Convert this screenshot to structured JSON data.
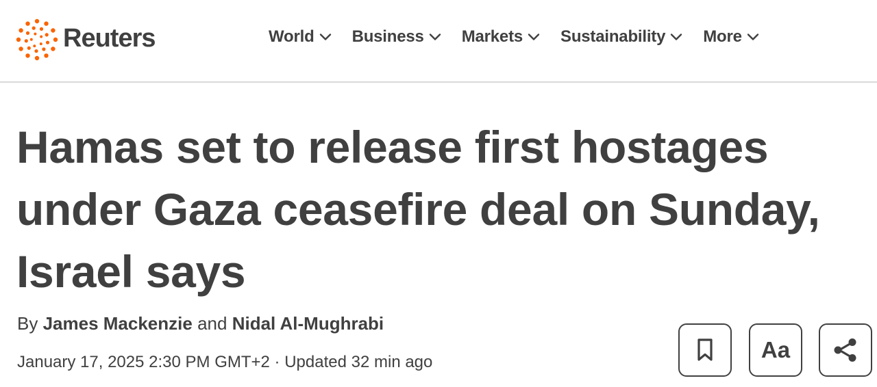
{
  "brand": {
    "name": "Reuters",
    "accent_color": "#fa6400"
  },
  "nav": {
    "items": [
      {
        "label": "World",
        "icon": "chevron-down-icon"
      },
      {
        "label": "Business",
        "icon": "chevron-down-icon"
      },
      {
        "label": "Markets",
        "icon": "chevron-down-icon"
      },
      {
        "label": "Sustainability",
        "icon": "chevron-down-icon"
      },
      {
        "label": "More",
        "icon": "chevron-down-icon"
      }
    ]
  },
  "article": {
    "headline_lines": [
      "Hamas set to release first hostages",
      "under Gaza ceasefire deal on Sunday,",
      "Israel says"
    ],
    "byline": {
      "prefix": "By",
      "author_1": "James Mackenzie",
      "conjunction": "and",
      "author_2": "Nidal Al-Mughrabi"
    },
    "date": "January 17, 2025 2:30 PM GMT+2",
    "separator": "·",
    "updated": "Updated 32 min ago"
  },
  "tools": {
    "bookmark_icon": "bookmark-icon",
    "text_size_label": "Aa",
    "share_icon": "share-icon"
  }
}
